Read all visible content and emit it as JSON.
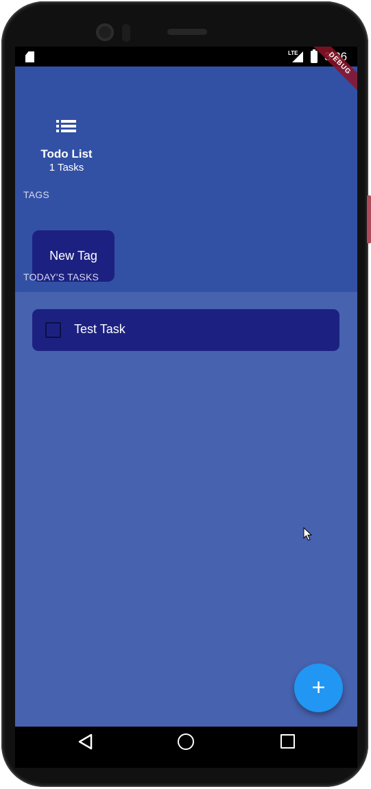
{
  "status_bar": {
    "network": "LTE",
    "time": "3:36",
    "debug_banner": "DEBUG"
  },
  "header": {
    "menu_icon": "list-icon",
    "title": "Todo List",
    "subtitle": "1 Tasks"
  },
  "tags": {
    "section_label": "TAGS",
    "items": [
      {
        "label": "New Tag"
      }
    ]
  },
  "tasks": {
    "section_label": "TODAY'S TASKS",
    "items": [
      {
        "label": "Test Task",
        "checked": false
      }
    ]
  },
  "fab": {
    "icon": "plus-icon",
    "symbol": "+"
  },
  "colors": {
    "header_bg": "#3251a5",
    "body_bg": "#4762ae",
    "card_bg": "#1c2181",
    "fab_bg": "#2196f3"
  },
  "nav_bar": {
    "icons": [
      "back-icon",
      "home-icon",
      "recents-icon"
    ]
  }
}
